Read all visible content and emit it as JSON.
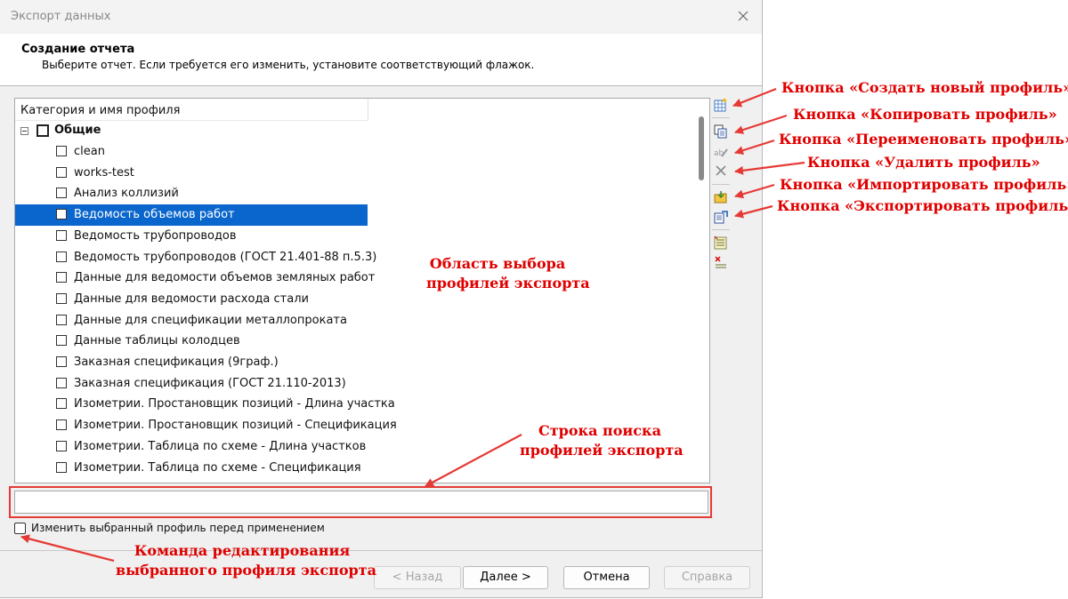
{
  "window": {
    "title": "Экспорт данных"
  },
  "header": {
    "title": "Создание отчета",
    "subtitle": "Выберите отчет. Если требуется его изменить, установите соответствующий флажок."
  },
  "tree": {
    "column_header": "Категория и имя профиля",
    "group": "Общие",
    "items": [
      "clean",
      "works-test",
      "Анализ коллизий",
      "Ведомость объемов работ",
      "Ведомость трубопроводов",
      "Ведомость трубопроводов (ГОСТ 21.401-88 п.5.3)",
      "Данные для ведомости объемов земляных работ",
      "Данные для ведомости расхода стали",
      "Данные для спецификации металлопроката",
      "Данные таблицы колодцев",
      "Заказная спецификация (9граф.)",
      "Заказная спецификация (ГОСТ 21.110-2013)",
      "Изометрии. Простановщик позиций - Длина участка",
      "Изометрии. Простановщик позиций - Спецификация",
      "Изометрии. Таблица по схеме - Длина участков",
      "Изометрии. Таблица по схеме - Спецификация"
    ],
    "selected_index": 3
  },
  "search": {
    "value": "",
    "placeholder": ""
  },
  "edit_checkbox": {
    "label": "Изменить выбранный профиль перед применением",
    "checked": false
  },
  "buttons": {
    "back": "< Назад",
    "next": "Далее >",
    "cancel": "Отмена",
    "help": "Справка"
  },
  "toolbar_icons": [
    "new-profile-icon",
    "copy-profile-icon",
    "rename-profile-icon",
    "delete-profile-icon",
    "import-profile-icon",
    "export-profile-icon",
    "select-all-icon",
    "clear-selection-icon"
  ],
  "annotations": {
    "create": "Кнопка «Создать новый профиль»",
    "copy": "Кнопка «Копировать профиль»",
    "rename": "Кнопка «Переименовать профиль»",
    "delete": "Кнопка «Удалить профиль»",
    "import": "Кнопка «Импортировать профиль»",
    "export": "Кнопка «Экспортировать профиль»",
    "area_line1": "Область выбора",
    "area_line2": "профилей экспорта",
    "search_line1": "Строка поиска",
    "search_line2": "профилей экспорта",
    "edit_line1": "Команда редактирования",
    "edit_line2": "выбранного профиля экспорта"
  },
  "colors": {
    "annotation": "#e00000",
    "selection": "#0a66cc"
  }
}
